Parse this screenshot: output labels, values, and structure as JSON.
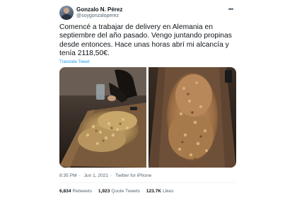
{
  "user": {
    "name": "Gonzalo N. Pérez",
    "handle": "@soygonzaloperez"
  },
  "more_icon": "more-horizontal-icon",
  "tweet": {
    "lines": [
      "Comencé a trabajar de delivery en Alemania en",
      "septiembre del año pasado. Vengo juntando propinas",
      "desde entonces. Hace unas horas abrí mi alcancía y",
      "tenía 2118,50€."
    ],
    "translate_label": "Translate Tweet"
  },
  "meta": {
    "time": "8:35 PM",
    "separator": "·",
    "date": "Jun 1, 2021",
    "source": "Twitter for iPhone"
  },
  "stats": [
    {
      "count": "6,834",
      "label": "Retweets"
    },
    {
      "count": "1,923",
      "label": "Quote Tweets"
    },
    {
      "count": "123.7K",
      "label": "Likes"
    }
  ],
  "colors": {
    "link": "#1d9bf0",
    "text": "#0f1419",
    "muted": "#536471"
  }
}
